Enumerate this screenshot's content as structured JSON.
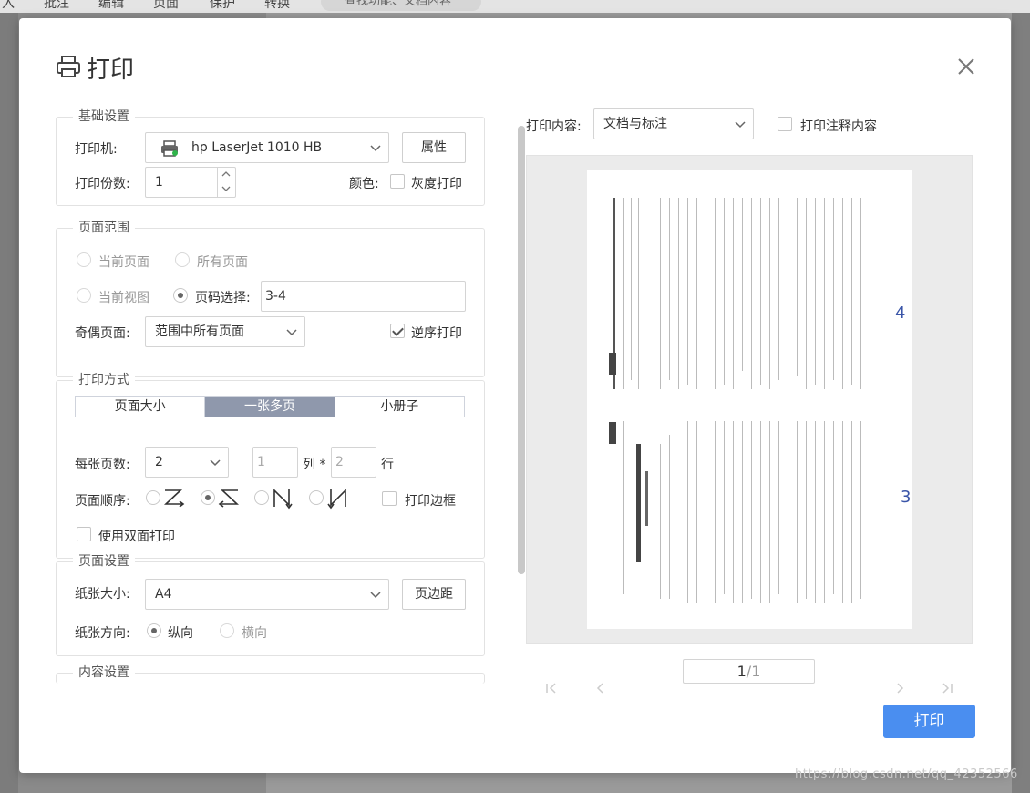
{
  "background": {
    "menu": [
      "入",
      "批注",
      "编辑",
      "页面",
      "保护",
      "转换"
    ],
    "search": "查找功能、文档内容",
    "watermark": "https://blog.csdn.net/qq_42352566"
  },
  "dialog": {
    "title": "打印",
    "basic": {
      "legend": "基础设置",
      "printer_label": "打印机:",
      "printer_value": "hp LaserJet 1010 HB",
      "properties_button": "属性",
      "copies_label": "打印份数:",
      "copies_value": "1",
      "color_label": "颜色:",
      "grayscale_label": "灰度打印"
    },
    "range": {
      "legend": "页面范围",
      "current_page": "当前页面",
      "all_pages": "所有页面",
      "current_view": "当前视图",
      "page_select_label": "页码选择:",
      "page_select_value": "3-4",
      "odd_even_label": "奇偶页面:",
      "odd_even_value": "范围中所有页面",
      "reverse_label": "逆序打印"
    },
    "mode": {
      "legend": "打印方式",
      "tabs": [
        "页面大小",
        "一张多页",
        "小册子"
      ],
      "per_sheet_label": "每张页数:",
      "per_sheet_value": "2",
      "cols_value": "1",
      "cols_label": "列 *",
      "rows_value": "2",
      "rows_label": "行",
      "order_label": "页面顺序:",
      "border_label": "打印边框",
      "duplex_label": "使用双面打印"
    },
    "page_setup": {
      "legend": "页面设置",
      "paper_label": "纸张大小:",
      "paper_value": "A4",
      "margins_button": "页边距",
      "orientation_label": "纸张方向:",
      "portrait": "纵向",
      "landscape": "横向"
    },
    "content": {
      "legend": "内容设置"
    },
    "preview": {
      "content_label": "打印内容:",
      "content_value": "文档与标注",
      "annotation_label": "打印注释内容",
      "page_top": "4",
      "page_bottom": "3",
      "pager_current": "1",
      "pager_total": "/1"
    },
    "print_button": "打印"
  }
}
